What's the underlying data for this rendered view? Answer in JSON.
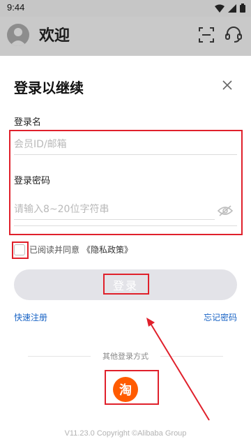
{
  "status_bar": {
    "time": "9:44"
  },
  "header": {
    "title": "欢迎"
  },
  "login": {
    "title": "登录以继续",
    "username_label": "登录名",
    "username_placeholder": "会员ID/邮箱",
    "password_label": "登录密码",
    "password_placeholder": "请输入8~20位字符串",
    "agree_text": "已阅读并同意",
    "privacy_link": "《隐私政策》",
    "login_button": "登录",
    "register_link": "快速注册",
    "forgot_link": "忘记密码",
    "other_methods": "其他登录方式",
    "taobao_glyph": "淘",
    "copyright": "V11.23.0    Copyright ©Alibaba Group"
  },
  "colors": {
    "accent_link": "#1863c5",
    "taobao": "#ff5b00",
    "highlight": "#e0202b"
  }
}
